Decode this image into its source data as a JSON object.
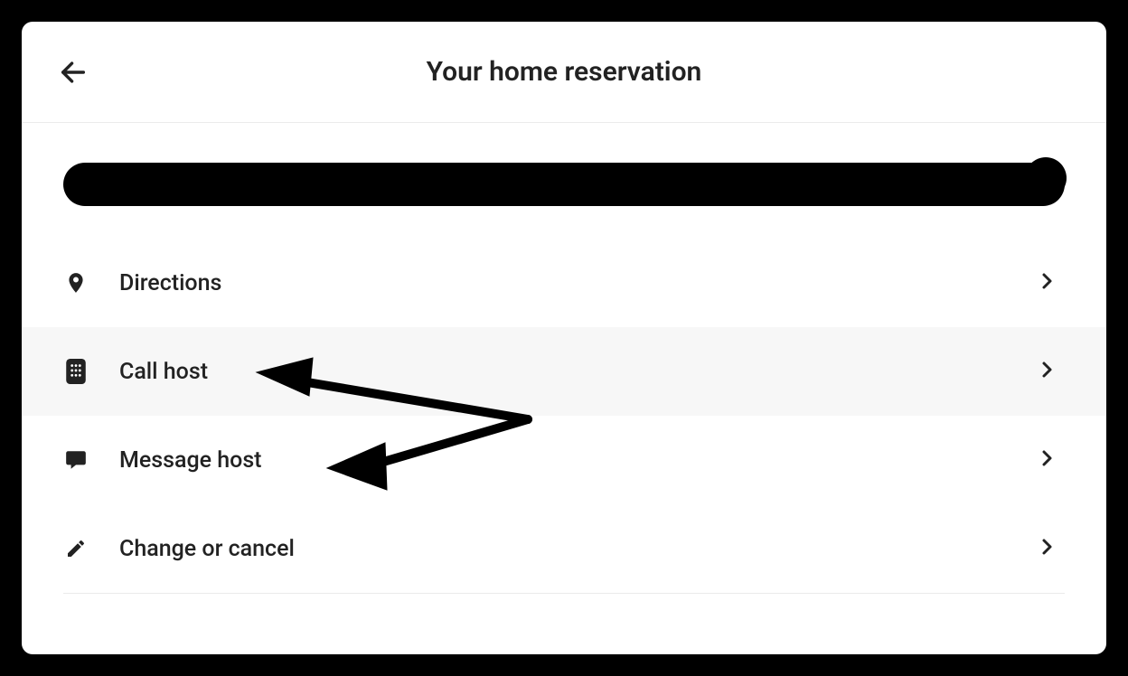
{
  "header": {
    "title": "Your home reservation"
  },
  "menu": {
    "items": [
      {
        "label": "Directions"
      },
      {
        "label": "Call host"
      },
      {
        "label": "Message host"
      },
      {
        "label": "Change or cancel"
      }
    ]
  }
}
